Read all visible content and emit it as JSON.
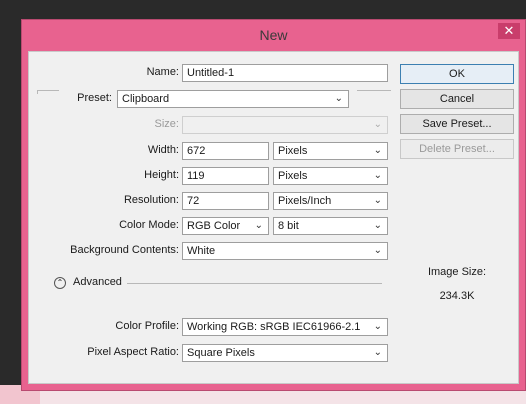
{
  "window": {
    "title": "New",
    "close_glyph": "✕",
    "accent": "#e8628f"
  },
  "form": {
    "name_label": "Name:",
    "name_value": "Untitled-1",
    "preset_label": "Preset:",
    "preset_value": "Clipboard",
    "size_label": "Size:",
    "size_value": "",
    "width_label": "Width:",
    "width_value": "672",
    "width_unit": "Pixels",
    "height_label": "Height:",
    "height_value": "119",
    "height_unit": "Pixels",
    "resolution_label": "Resolution:",
    "resolution_value": "72",
    "resolution_unit": "Pixels/Inch",
    "color_mode_label": "Color Mode:",
    "color_mode_value": "RGB Color",
    "bit_depth_value": "8 bit",
    "background_label": "Background Contents:",
    "background_value": "White",
    "advanced_label": "Advanced",
    "advanced_glyph": "⌃",
    "color_profile_label": "Color Profile:",
    "color_profile_value": "Working RGB:  sRGB IEC61966-2.1",
    "pixel_aspect_label": "Pixel Aspect Ratio:",
    "pixel_aspect_value": "Square Pixels",
    "chevron": "⌄"
  },
  "buttons": {
    "ok": "OK",
    "cancel": "Cancel",
    "save_preset": "Save Preset...",
    "delete_preset": "Delete Preset..."
  },
  "info": {
    "image_size_label": "Image Size:",
    "image_size_value": "234.3K"
  }
}
